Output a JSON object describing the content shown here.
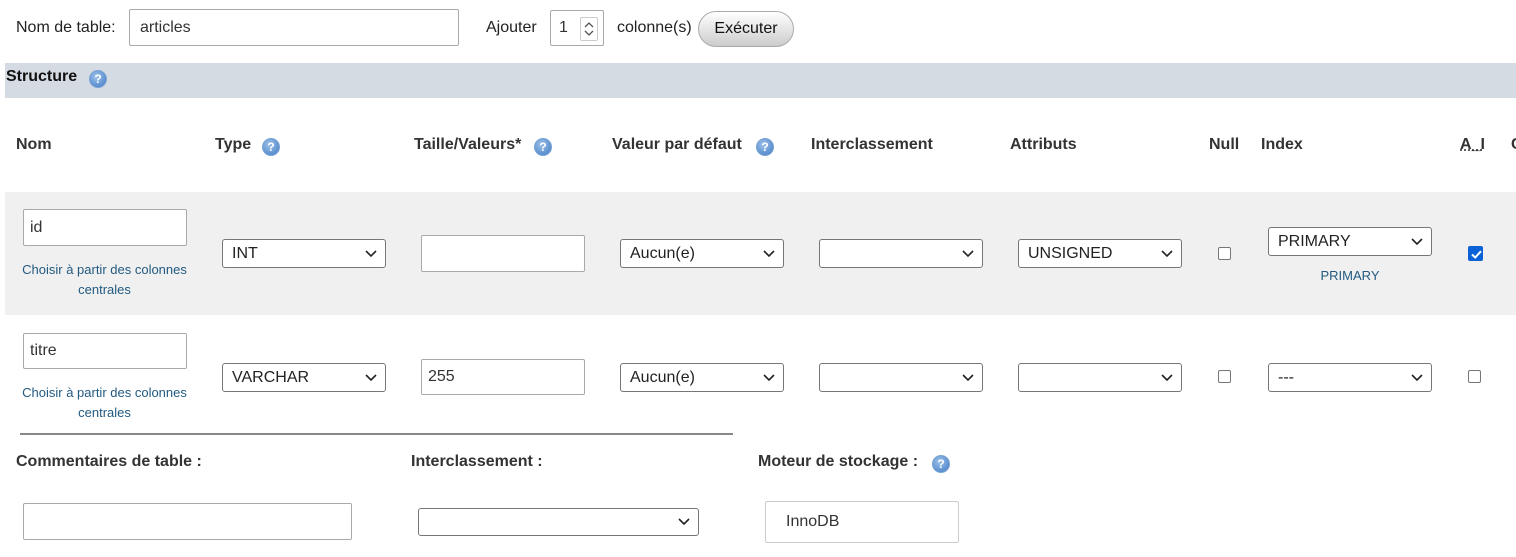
{
  "top": {
    "table_name_label": "Nom de table:",
    "table_name_value": "articles",
    "add_label": "Ajouter",
    "add_count": "1",
    "columns_label": "colonne(s)",
    "execute_label": "Exécuter"
  },
  "structure": {
    "title": "Structure",
    "help_icon": "question-circle-icon"
  },
  "headers": {
    "name": "Nom",
    "type": "Type",
    "size": "Taille/Valeurs*",
    "default": "Valeur par défaut",
    "collation": "Interclassement",
    "attributes": "Attributs",
    "null": "Null",
    "index": "Index",
    "ai": "A_I",
    "cut": "C"
  },
  "rows": [
    {
      "name": "id",
      "central_link": "Choisir à partir des colonnes centrales",
      "type": "INT",
      "size": "",
      "default": "Aucun(e)",
      "collation": "",
      "attributes": "UNSIGNED",
      "null_checked": false,
      "index": "PRIMARY",
      "index_note": "PRIMARY",
      "ai_checked": true
    },
    {
      "name": "titre",
      "central_link": "Choisir à partir des colonnes centrales",
      "type": "VARCHAR",
      "size": "255",
      "default": "Aucun(e)",
      "collation": "",
      "attributes": "",
      "null_checked": false,
      "index": "---",
      "index_note": "",
      "ai_checked": false
    }
  ],
  "footer": {
    "comments_label": "Commentaires de table :",
    "comments_value": "",
    "collation_label": "Interclassement :",
    "collation_value": "",
    "engine_label": "Moteur de stockage :",
    "engine_value": "InnoDB"
  },
  "colors": {
    "structure_bar": "#d5dbe3",
    "row_stripe": "#f0f0f0",
    "link": "#235a81",
    "checkbox_checked": "#0b61d6"
  }
}
